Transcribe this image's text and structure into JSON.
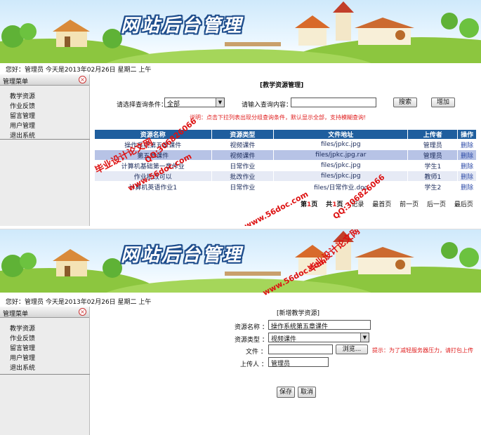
{
  "banner": {
    "title": "网站后台管理"
  },
  "colors": {
    "header_blue": "#1f5e9e",
    "row_alt": "#e6eaf5",
    "row_selected": "#b7c3e6",
    "note_red": "#e02020",
    "sidebar_bg": "#ececec"
  },
  "greeting": "您好：管理员  今天是2013年02月26日  星期二  上午",
  "sidebar": {
    "title": "管理菜单",
    "close_icon": "circle-close-icon",
    "items": [
      "教学资源",
      "作业反馈",
      "留言管理",
      "用户管理",
      "退出系统"
    ]
  },
  "list_page": {
    "section_title": "[教学资源管理]",
    "filter_label": "请选择查询条件：",
    "filter_value": "全部",
    "query_label": "请输入查询内容：",
    "query_value": "",
    "search_button": "搜索",
    "add_button": "增加",
    "note": "说明：点击下拉列表出现分组查询条件，默认显示全部，支持模糊查询!",
    "columns": [
      "资源名称",
      "资源类型",
      "文件地址",
      "上传者",
      "操作"
    ],
    "rows": [
      {
        "name": "操作系统第五章课件",
        "type": "视频课件",
        "path": "files/jpkc.jpg",
        "uploader": "管理员",
        "action": "删除"
      },
      {
        "name": "第五章课件",
        "type": "视频课件",
        "path": "files/jpkc.jpg.rar",
        "uploader": "管理员",
        "action": "删除"
      },
      {
        "name": "计算机基础第一章作业",
        "type": "日常作业",
        "path": "files/jpkc.jpg",
        "uploader": "学生1",
        "action": "删除"
      },
      {
        "name": "作业批改可以",
        "type": "批改作业",
        "path": "files/jpkc.jpg",
        "uploader": "教师1",
        "action": "删除"
      },
      {
        "name": "计算机英语作业1",
        "type": "日常作业",
        "path": "files/日常作业.doc",
        "uploader": "学生2",
        "action": "删除"
      }
    ],
    "pager": {
      "current_prefix": "第",
      "current": "1",
      "current_suffix": "页",
      "total_prefix": "共",
      "total": "1",
      "total_suffix": "页",
      "records": "记录",
      "first": "最首页",
      "prev": "前一页",
      "next": "后一页",
      "last": "最后页"
    }
  },
  "add_page": {
    "section_title": "[新增教学资源]",
    "name_label": "资源名称 ：",
    "name_value": "操作系统第五章课件",
    "type_label": "资源类型 ：",
    "type_value": "视频课件",
    "file_label": "文件 ：",
    "file_value": "",
    "browse_button": "浏览...",
    "hint": "提示：为了减轻服务器压力，请打包上传",
    "uploader_label": "上传人 ：",
    "uploader_value": "管理员",
    "save_button": "保存",
    "cancel_button": "取消"
  },
  "watermarks": [
    "www.56doc.com",
    "毕业设计论文网",
    "QQ:306826066"
  ]
}
